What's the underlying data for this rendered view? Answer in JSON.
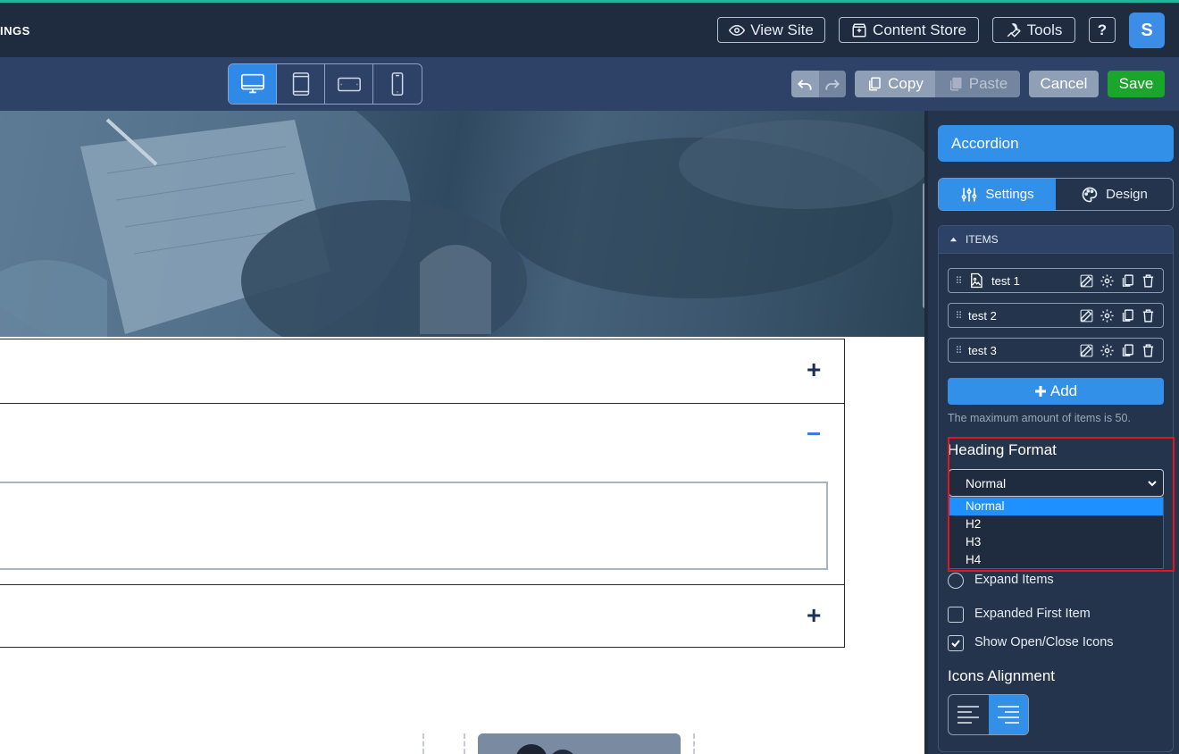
{
  "header": {
    "brand": "INGS",
    "view_site": "View Site",
    "content_store": "Content Store",
    "tools": "Tools",
    "help": "?",
    "avatar": "S"
  },
  "toolbar": {
    "devices": [
      "desktop",
      "tablet-portrait",
      "tablet-landscape",
      "mobile"
    ],
    "active_device": "desktop",
    "copy": "Copy",
    "paste": "Paste",
    "cancel": "Cancel",
    "save": "Save"
  },
  "canvas": {
    "accordion_open_icon": "+",
    "accordion_close_icon": "−"
  },
  "panel": {
    "title": "Accordion",
    "tabs": [
      {
        "label": "Settings",
        "icon": "sliders-icon",
        "active": true
      },
      {
        "label": "Design",
        "icon": "palette-icon",
        "active": false
      }
    ],
    "section_title": "ITEMS",
    "items": [
      {
        "label": "test 1",
        "has_image": true
      },
      {
        "label": "test 2",
        "has_image": false
      },
      {
        "label": "test 3",
        "has_image": false
      }
    ],
    "add_label": "Add",
    "max_hint": "The maximum amount of items is 50.",
    "heading_format": {
      "label": "Heading Format",
      "value": "Normal",
      "options": [
        "Normal",
        "H2",
        "H3",
        "H4"
      ],
      "highlighted": "Normal"
    },
    "expand_items": "Expand Items",
    "expanded_first_item": "Expanded First Item",
    "expanded_first_checked": false,
    "show_icons": "Show Open/Close Icons",
    "show_icons_checked": true,
    "icons_alignment": {
      "label": "Icons Alignment",
      "value": "right"
    }
  },
  "colors": {
    "accent": "#3390e8",
    "save": "#1aa52b",
    "highlight_border": "#e4151f"
  }
}
